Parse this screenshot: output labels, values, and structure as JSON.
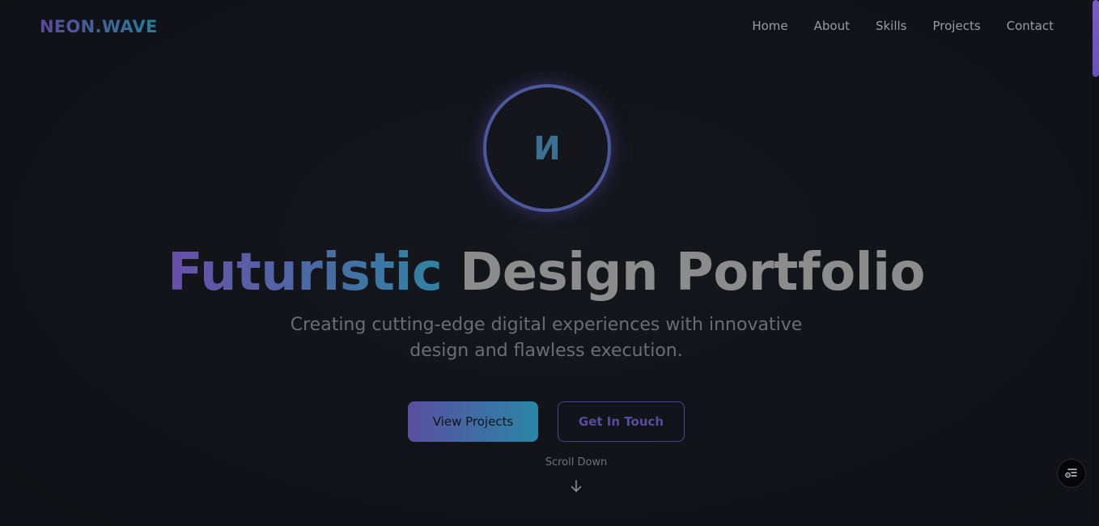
{
  "brand": {
    "logo": "NEON.WAVE"
  },
  "nav": {
    "items": [
      "Home",
      "About",
      "Skills",
      "Projects",
      "Contact"
    ]
  },
  "avatar": {
    "glyph": "И"
  },
  "hero": {
    "title_highlight": "Futuristic",
    "title_rest": "Design Portfolio",
    "subtitle": "Creating cutting-edge digital experiences with innovative design and flawless execution."
  },
  "buttons": {
    "primary": "View Projects",
    "secondary": "Get In Touch"
  },
  "scroll": {
    "label": "Scroll Down",
    "icon": "arrow-down-icon"
  },
  "widget": {
    "icon": "settings-list-icon"
  },
  "colors": {
    "background": "#111318",
    "accent_purple": "#6a4fa8",
    "accent_teal": "#2f83a2",
    "scrollbar": "#7a5ad0"
  }
}
